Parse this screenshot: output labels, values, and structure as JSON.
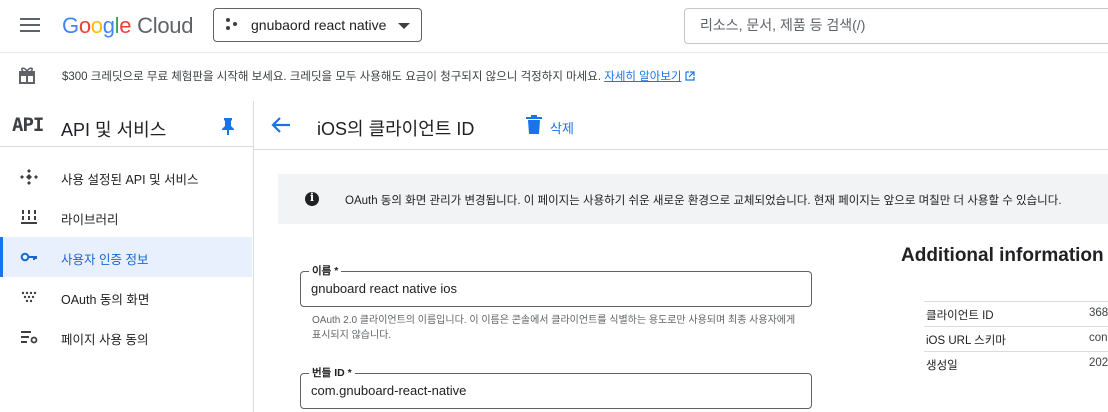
{
  "header": {
    "logo_google": [
      "G",
      "o",
      "o",
      "g",
      "l",
      "e"
    ],
    "logo_cloud": "Cloud",
    "project_name": "gnubaord react native",
    "search_placeholder": "리소스, 문서, 제품 등 검색(/)"
  },
  "banner": {
    "text": "$300 크레딧으로 무료 체험판을 시작해 보세요. 크레딧을 모두 사용해도 요금이 청구되지 않으니 걱정하지 마세요.",
    "link": "자세히 알아보기"
  },
  "sidebar": {
    "badge": "API",
    "title": "API 및 서비스",
    "items": [
      {
        "label": "사용 설정된 API 및 서비스",
        "icon": "api-diamond-icon",
        "active": false
      },
      {
        "label": "라이브러리",
        "icon": "library-icon",
        "active": false
      },
      {
        "label": "사용자 인증 정보",
        "icon": "key-icon",
        "active": true
      },
      {
        "label": "OAuth 동의 화면",
        "icon": "oauth-dots-icon",
        "active": false
      },
      {
        "label": "페이지 사용 동의",
        "icon": "settings-list-icon",
        "active": false
      }
    ]
  },
  "main": {
    "title": "iOS의 클라이언트 ID",
    "delete_label": "삭제",
    "notice": "OAuth 동의 화면 관리가 변경됩니다. 이 페이지는 사용하기 쉬운 새로운 환경으로 교체되었습니다. 현재 페이지는 앞으로 며칠만 더 사용할 수 있습니다.",
    "name_field": {
      "label": "이름 *",
      "value": "gnuboard react native ios",
      "help": "OAuth 2.0 클라이언트의 이름입니다. 이 이름은 콘솔에서 클라이언트를 식별하는 용도로만 사용되며 최종 사용자에게 표시되지 않습니다."
    },
    "bundle_field": {
      "label": "번들 ID *",
      "value": "com.gnuboard-react-native"
    }
  },
  "additional": {
    "title": "Additional information",
    "rows": [
      {
        "key": "클라이언트 ID",
        "value": "368"
      },
      {
        "key": "iOS URL 스키마",
        "value": "con"
      },
      {
        "key": "생성일",
        "value": "202"
      }
    ]
  },
  "colors": {
    "accent": "#1a73e8",
    "active_bg": "#e8f0fe",
    "notice_bg": "#f1f3f4"
  }
}
